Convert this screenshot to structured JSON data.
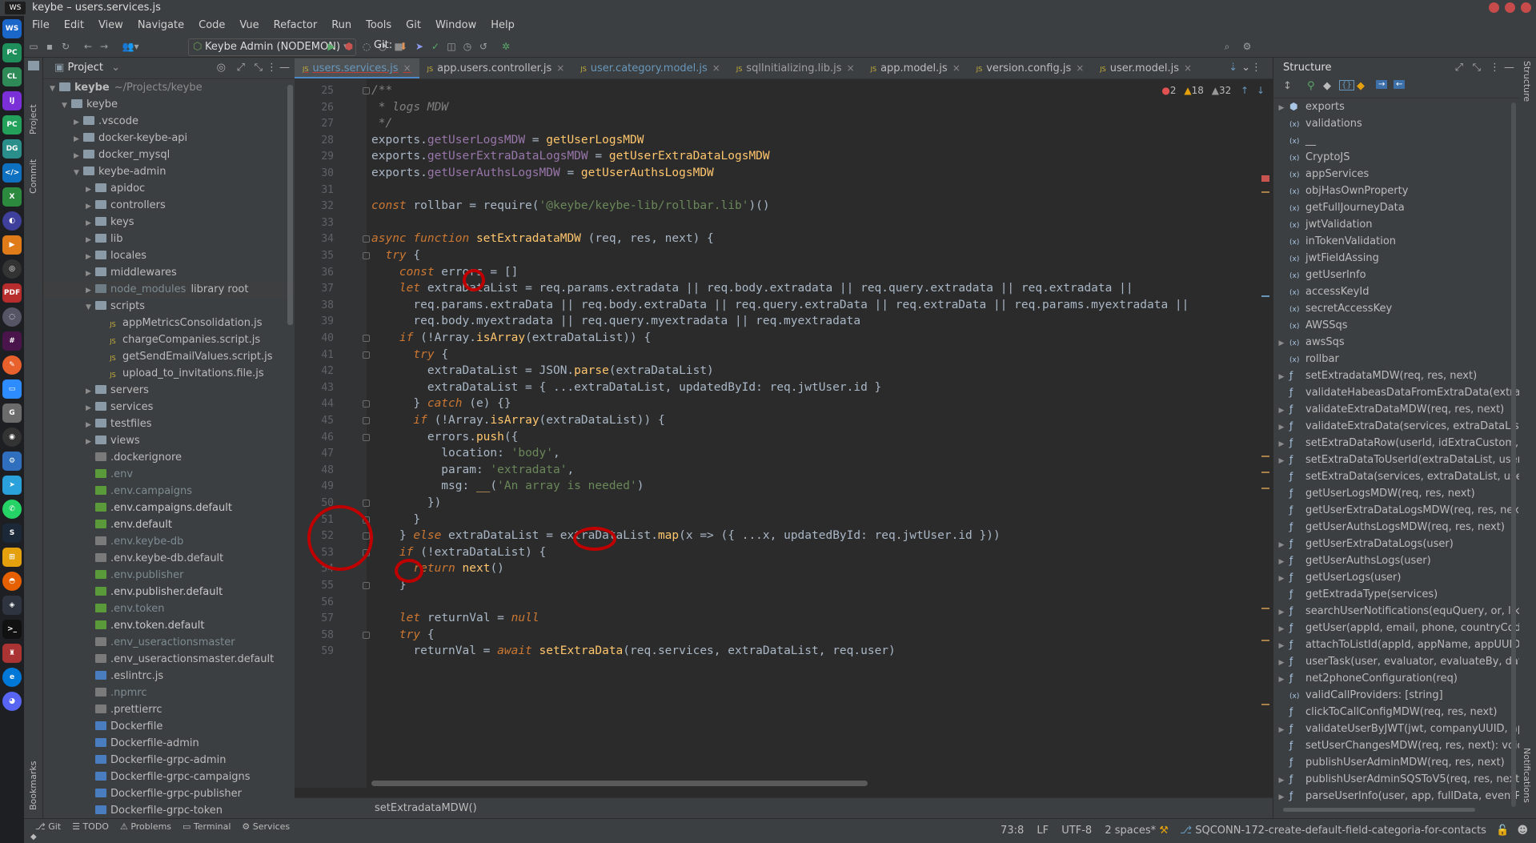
{
  "window": {
    "title": "keybe – users.services.js"
  },
  "menu": [
    "File",
    "Edit",
    "View",
    "Navigate",
    "Code",
    "Vue",
    "Refactor",
    "Run",
    "Tools",
    "Git",
    "Window",
    "Help"
  ],
  "toolbar": {
    "run_config": "Keybe Admin (NODEMON)",
    "git_label": "Git:"
  },
  "project_panel": {
    "title": "Project",
    "tree": [
      {
        "label": "keybe",
        "extra": "~/Projects/keybe",
        "icon": "folder",
        "depth": 0,
        "arrow": "down",
        "bold": true
      },
      {
        "label": "keybe",
        "icon": "folder",
        "depth": 1,
        "arrow": "down"
      },
      {
        "label": ".vscode",
        "icon": "folder",
        "depth": 2,
        "arrow": "right"
      },
      {
        "label": "docker-keybe-api",
        "icon": "folder",
        "depth": 2,
        "arrow": "right"
      },
      {
        "label": "docker_mysql",
        "icon": "folder",
        "depth": 2,
        "arrow": "right"
      },
      {
        "label": "keybe-admin",
        "icon": "folder",
        "depth": 2,
        "arrow": "down"
      },
      {
        "label": "apidoc",
        "icon": "folder",
        "depth": 3,
        "arrow": "right"
      },
      {
        "label": "controllers",
        "icon": "folder",
        "depth": 3,
        "arrow": "right"
      },
      {
        "label": "keys",
        "icon": "folder",
        "depth": 3,
        "arrow": "right"
      },
      {
        "label": "lib",
        "icon": "folder",
        "depth": 3,
        "arrow": "right"
      },
      {
        "label": "locales",
        "icon": "folder",
        "depth": 3,
        "arrow": "right"
      },
      {
        "label": "middlewares",
        "icon": "folder",
        "depth": 3,
        "arrow": "right"
      },
      {
        "label": "node_modules",
        "extra": "library root",
        "icon": "folderg",
        "depth": 3,
        "arrow": "right",
        "dim": true
      },
      {
        "label": "scripts",
        "icon": "folder",
        "depth": 3,
        "arrow": "down"
      },
      {
        "label": "appMetricsConsolidation.js",
        "icon": "js",
        "depth": 4,
        "arrow": ""
      },
      {
        "label": "chargeCompanies.script.js",
        "icon": "js",
        "depth": 4,
        "arrow": ""
      },
      {
        "label": "getSendEmailValues.script.js",
        "icon": "js",
        "depth": 4,
        "arrow": ""
      },
      {
        "label": "upload_to_invitations.file.js",
        "icon": "js",
        "depth": 4,
        "arrow": ""
      },
      {
        "label": "servers",
        "icon": "folder",
        "depth": 3,
        "arrow": "right"
      },
      {
        "label": "services",
        "icon": "folder",
        "depth": 3,
        "arrow": "right"
      },
      {
        "label": "testfiles",
        "icon": "folder",
        "depth": 3,
        "arrow": "right"
      },
      {
        "label": "views",
        "icon": "folder",
        "depth": 3,
        "arrow": "right"
      },
      {
        "label": ".dockerignore",
        "icon": "gray",
        "depth": 3,
        "arrow": ""
      },
      {
        "label": ".env",
        "icon": "env",
        "depth": 3,
        "arrow": "",
        "dim": true
      },
      {
        "label": ".env.campaigns",
        "icon": "env",
        "depth": 3,
        "arrow": "",
        "dim": true
      },
      {
        "label": ".env.campaigns.default",
        "icon": "env",
        "depth": 3,
        "arrow": ""
      },
      {
        "label": ".env.default",
        "icon": "env",
        "depth": 3,
        "arrow": ""
      },
      {
        "label": ".env.keybe-db",
        "icon": "gray",
        "depth": 3,
        "arrow": "",
        "dim": true
      },
      {
        "label": ".env.keybe-db.default",
        "icon": "gray",
        "depth": 3,
        "arrow": ""
      },
      {
        "label": ".env.publisher",
        "icon": "env",
        "depth": 3,
        "arrow": "",
        "dim": true
      },
      {
        "label": ".env.publisher.default",
        "icon": "env",
        "depth": 3,
        "arrow": ""
      },
      {
        "label": ".env.token",
        "icon": "env",
        "depth": 3,
        "arrow": "",
        "dim": true
      },
      {
        "label": ".env.token.default",
        "icon": "env",
        "depth": 3,
        "arrow": ""
      },
      {
        "label": ".env_useractionsmaster",
        "icon": "gray",
        "depth": 3,
        "arrow": "",
        "dim": true
      },
      {
        "label": ".env_useractionsmaster.default",
        "icon": "gray",
        "depth": 3,
        "arrow": ""
      },
      {
        "label": ".eslintrc.js",
        "icon": "doc",
        "depth": 3,
        "arrow": ""
      },
      {
        "label": ".npmrc",
        "icon": "gray",
        "depth": 3,
        "arrow": "",
        "dim": true
      },
      {
        "label": ".prettierrc",
        "icon": "gray",
        "depth": 3,
        "arrow": ""
      },
      {
        "label": "Dockerfile",
        "icon": "doc",
        "depth": 3,
        "arrow": ""
      },
      {
        "label": "Dockerfile-admin",
        "icon": "doc",
        "depth": 3,
        "arrow": ""
      },
      {
        "label": "Dockerfile-grpc-admin",
        "icon": "doc",
        "depth": 3,
        "arrow": ""
      },
      {
        "label": "Dockerfile-grpc-campaigns",
        "icon": "doc",
        "depth": 3,
        "arrow": ""
      },
      {
        "label": "Dockerfile-grpc-publisher",
        "icon": "doc",
        "depth": 3,
        "arrow": ""
      },
      {
        "label": "Dockerfile-grpc-token",
        "icon": "doc",
        "depth": 3,
        "arrow": ""
      }
    ]
  },
  "editor": {
    "tabs": [
      {
        "label": "users.services.js",
        "active": true
      },
      {
        "label": "app.users.controller.js"
      },
      {
        "label": "user.category.model.js"
      },
      {
        "label": "sqlInitializing.lib.js"
      },
      {
        "label": "app.model.js"
      },
      {
        "label": "version.config.js"
      },
      {
        "label": "user.model.js"
      }
    ],
    "inspections": {
      "errors": "2",
      "warnings": "18",
      "weak": "32"
    },
    "breadcrumb": "setExtradataMDW()",
    "lines": [
      {
        "n": "25",
        "html": "<span class='cm'>/**</span>"
      },
      {
        "n": "26",
        "html": "<span class='cm'> * logs MDW</span>"
      },
      {
        "n": "27",
        "html": "<span class='cm'> */</span>"
      },
      {
        "n": "28",
        "html": "exports.<span class='prop'>getUserLogsMDW</span> = <span class='fn'>getUserLogsMDW</span>"
      },
      {
        "n": "29",
        "html": "exports.<span class='prop'>getUserExtraDataLogsMDW</span> = <span class='fn'>getUserExtraDataLogsMDW</span>"
      },
      {
        "n": "30",
        "html": "exports.<span class='prop'>getUserAuthsLogsMDW</span> = <span class='fn'>getUserAuthsLogsMDW</span>"
      },
      {
        "n": "31",
        "html": ""
      },
      {
        "n": "32",
        "html": "<span class='kw'>const</span> rollbar = require(<span class='str'>'@keybe/keybe-lib/rollbar.lib'</span>)()"
      },
      {
        "n": "33",
        "html": ""
      },
      {
        "n": "34",
        "html": "<span class='kw'>async function</span> <span class='fn'>setExtradataMDW</span> (req, res, next) {"
      },
      {
        "n": "35",
        "html": "  <span class='kw'>try</span> {"
      },
      {
        "n": "36",
        "html": "    <span class='kw'>const</span> errors = []"
      },
      {
        "n": "37",
        "html": "    <span class='kw'>let</span> extraDataList = req.params.extradata || req.body.extradata || req.query.extradata || req.extradata ||"
      },
      {
        "n": "38",
        "html": "      req.params.extraData || req.body.extraData || req.query.extraData || req.extraData || req.params.myextradata ||"
      },
      {
        "n": "39",
        "html": "      req.body.myextradata || req.query.myextradata || req.myextradata"
      },
      {
        "n": "40",
        "html": "    <span class='kw'>if</span> (!Array.<span class='fn'>isArray</span>(extraDataList)) {"
      },
      {
        "n": "41",
        "html": "      <span class='kw'>try</span> {"
      },
      {
        "n": "42",
        "html": "        extraDataList = JSON.<span class='fn'>parse</span>(extraDataList)"
      },
      {
        "n": "43",
        "html": "        extraDataList = { ...extraDataList, updatedById: req.jwtUser.id }"
      },
      {
        "n": "44",
        "html": "      } <span class='kw'>catch</span> (e) {}"
      },
      {
        "n": "45",
        "html": "      <span class='kw'>if</span> (!Array.<span class='fn'>isArray</span>(extraDataList)) {"
      },
      {
        "n": "46",
        "html": "        errors.<span class='fn'>push</span>({"
      },
      {
        "n": "47",
        "html": "          location: <span class='str'>'body'</span>,"
      },
      {
        "n": "48",
        "html": "          param: <span class='str'>'extradata'</span>,"
      },
      {
        "n": "49",
        "html": "          msg: <span class='fn'>__</span>(<span class='str'>'An array is needed'</span>)"
      },
      {
        "n": "50",
        "html": "        })"
      },
      {
        "n": "51",
        "html": "      }"
      },
      {
        "n": "52",
        "html": "    } <span class='kw'>else</span> extraDataList = extraDataList.<span class='fn'>map</span>(x =&gt; ({ ...x, updatedById: req.jwtUser.id }))"
      },
      {
        "n": "53",
        "html": "    <span class='kw'>if</span> (!extraDataList) {"
      },
      {
        "n": "54",
        "html": "      <span class='kw'>return</span> <span class='fn'>next</span>()"
      },
      {
        "n": "55",
        "html": "    }"
      },
      {
        "n": "56",
        "html": ""
      },
      {
        "n": "57",
        "html": "    <span class='kw'>let</span> returnVal = <span class='kw'>null</span>"
      },
      {
        "n": "58",
        "html": "    <span class='kw'>try</span> {"
      },
      {
        "n": "59",
        "html": "      returnVal = <span class='kw'>await</span> <span class='fn'>setExtraData</span>(req.services, extraDataList, req.user)"
      }
    ]
  },
  "structure": {
    "title": "Structure",
    "items": [
      {
        "label": "exports",
        "icon": "obj",
        "arrow": true
      },
      {
        "label": "validations",
        "icon": "var"
      },
      {
        "label": "__",
        "icon": "var"
      },
      {
        "label": "CryptoJS",
        "icon": "var"
      },
      {
        "label": "appServices",
        "icon": "var"
      },
      {
        "label": "objHasOwnProperty",
        "icon": "var"
      },
      {
        "label": "getFullJourneyData",
        "icon": "var"
      },
      {
        "label": "jwtValidation",
        "icon": "var"
      },
      {
        "label": "inTokenValidation",
        "icon": "var"
      },
      {
        "label": "jwtFieldAssing",
        "icon": "var"
      },
      {
        "label": "getUserInfo",
        "icon": "var"
      },
      {
        "label": "accessKeyId",
        "icon": "var"
      },
      {
        "label": "secretAccessKey",
        "icon": "var"
      },
      {
        "label": "AWSSqs",
        "icon": "var"
      },
      {
        "label": "awsSqs",
        "icon": "var",
        "arrow": true
      },
      {
        "label": "rollbar",
        "icon": "var"
      },
      {
        "label": "setExtradataMDW(req, res, next)",
        "icon": "fn",
        "arrow": true
      },
      {
        "label": "validateHabeasDataFromExtraData(extraDa",
        "icon": "fn"
      },
      {
        "label": "validateExtraDataMDW(req, res, next)",
        "icon": "fn",
        "arrow": true
      },
      {
        "label": "validateExtraData(services, extraDataList,",
        "icon": "fn",
        "arrow": true
      },
      {
        "label": "setExtraDataRow(userId, idExtraCustom, ext",
        "icon": "fn",
        "arrow": true
      },
      {
        "label": "setExtraDataToUserId(extraDataList, userId",
        "icon": "fn",
        "arrow": true
      },
      {
        "label": "setExtraData(services, extraDataList, user,",
        "icon": "fn"
      },
      {
        "label": "getUserLogsMDW(req, res, next)",
        "icon": "fn"
      },
      {
        "label": "getUserExtraDataLogsMDW(req, res, next)",
        "icon": "fn"
      },
      {
        "label": "getUserAuthsLogsMDW(req, res, next)",
        "icon": "fn"
      },
      {
        "label": "getUserExtraDataLogs(user)",
        "icon": "fn",
        "arrow": true
      },
      {
        "label": "getUserAuthsLogs(user)",
        "icon": "fn",
        "arrow": true
      },
      {
        "label": "getUserLogs(user)",
        "icon": "fn",
        "arrow": true
      },
      {
        "label": "getExtradaType(services)",
        "icon": "fn"
      },
      {
        "label": "searchUserNotifications(equQuery, or, like",
        "icon": "fn",
        "arrow": true
      },
      {
        "label": "getUser(appId, email, phone, countryCode,",
        "icon": "fn",
        "arrow": true
      },
      {
        "label": "attachToListId(appId, appName, appUUID,",
        "icon": "fn",
        "arrow": true
      },
      {
        "label": "userTask(user, evaluator, evaluateBy, date",
        "icon": "fn",
        "arrow": true
      },
      {
        "label": "net2phoneConfiguration(req)",
        "icon": "fn",
        "arrow": true
      },
      {
        "label": "validCallProviders: [string]",
        "icon": "var"
      },
      {
        "label": "clickToCallConfigMDW(req, res, next)",
        "icon": "fn"
      },
      {
        "label": "validateUserByJWT(jwt, companyUUID, app",
        "icon": "fn",
        "arrow": true
      },
      {
        "label": "setUserChangesMDW(req, res, next): void",
        "icon": "fn"
      },
      {
        "label": "publishUserAdminMDW(req, res, next)",
        "icon": "fn"
      },
      {
        "label": "publishUserAdminSQSToV5(req, res, next)",
        "icon": "fn",
        "arrow": true
      },
      {
        "label": "parseUserInfo(user, app, fullData, eventPa",
        "icon": "fn",
        "arrow": true
      }
    ]
  },
  "bottom_tools": [
    "Git",
    "TODO",
    "Problems",
    "Terminal",
    "Services"
  ],
  "status": {
    "position": "73:8",
    "line_sep": "LF",
    "encoding": "UTF-8",
    "indent": "2 spaces*",
    "branch": "SQCONN-172-create-default-field-categoria-for-contacts"
  },
  "left_tool_labels": {
    "project": "Project",
    "commit": "Commit",
    "bookmarks": "Bookmarks"
  },
  "right_tool_labels": {
    "structure": "Structure",
    "notifications": "Notifications"
  }
}
